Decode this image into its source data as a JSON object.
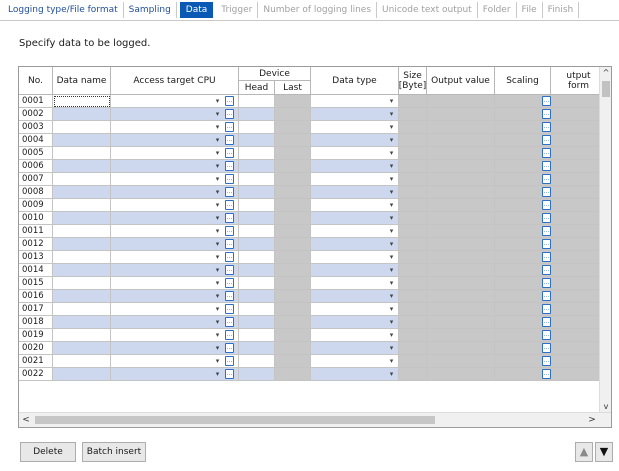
{
  "tabs": [
    {
      "label": "Logging type/File format",
      "state": "done"
    },
    {
      "label": "Sampling",
      "state": "done"
    },
    {
      "label": "Data",
      "state": "active"
    },
    {
      "label": "Trigger",
      "state": "future"
    },
    {
      "label": "Number of logging lines",
      "state": "future"
    },
    {
      "label": "Unicode text output",
      "state": "future"
    },
    {
      "label": "Folder",
      "state": "future"
    },
    {
      "label": "File",
      "state": "future"
    },
    {
      "label": "Finish",
      "state": "future"
    }
  ],
  "instruction": "Specify data to be logged.",
  "table": {
    "headers": {
      "no": "No.",
      "data_name": "Data name",
      "access_target_cpu": "Access target CPU",
      "device": "Device",
      "head": "Head",
      "last": "Last",
      "data_type": "Data type",
      "size": "Size [Byte]",
      "output_value": "Output value",
      "scaling": "Scaling",
      "output_format": "utput form"
    },
    "rows": [
      "0001",
      "0002",
      "0003",
      "0004",
      "0005",
      "0006",
      "0007",
      "0008",
      "0009",
      "0010",
      "0011",
      "0012",
      "0013",
      "0014",
      "0015",
      "0016",
      "0017",
      "0018",
      "0019",
      "0020",
      "0021",
      "0022"
    ]
  },
  "icons": {
    "dropdown": "▾",
    "ellipsis": "…",
    "scroll_up": "^",
    "scroll_down": "v",
    "scroll_left": "<",
    "scroll_right": ">",
    "move_up": "▲",
    "move_down": "▼"
  },
  "buttons": {
    "delete": "Delete",
    "batch_insert": "Batch insert"
  },
  "colors": {
    "active_tab": "#0a59b5",
    "alt_row": "#cdd8ef",
    "disabled_cell": "#c8c8c8"
  }
}
